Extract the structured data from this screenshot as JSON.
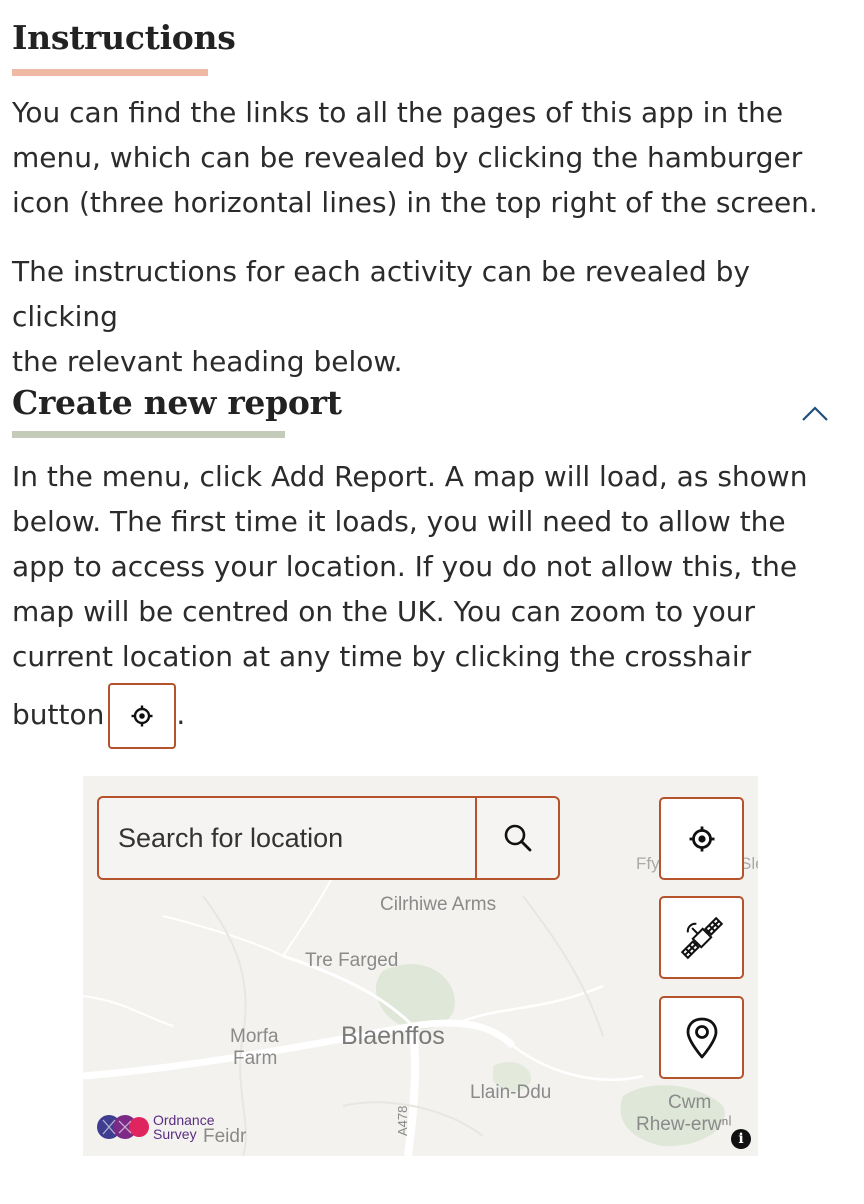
{
  "instructions": {
    "heading": "Instructions",
    "para1_line1": "You can find the links to all the pages of this app in the",
    "para1_line2": "menu, which can be revealed by clicking the hamburger",
    "para1_line3": "icon (three horizontal lines) in the top right of the screen.",
    "para2_line1": "The instructions for each activity can be revealed by clicking",
    "para2_line2": "the relevant heading below."
  },
  "create_report": {
    "heading": "Create new report",
    "line1": "In the menu, click Add Report. A map will load, as shown",
    "line2": "below. The first time it loads, you will need to allow the",
    "line3": "app to access your location. If you do not allow this, the",
    "line4": "map will be centred on the UK. You can zoom to your",
    "line5": "current location at any time by clicking the crosshair",
    "line6_start": "button",
    "line6_end": "."
  },
  "map": {
    "search_placeholder": "Search for location",
    "places": {
      "cilrhiwe": "Cilrhiwe Arms",
      "tre_farged": "Tre Farged",
      "morfa": "Morfa",
      "farm": "Farm",
      "blaenffos": "Blaenffos",
      "llain_ddu": "Llain-Ddu",
      "cwm": "Cwm",
      "rhew": "Rhew-erwⁿˡ",
      "feidr": "Feidr",
      "ffy": "Ffy",
      "sle": "Sle",
      "road": "A478"
    },
    "os_logo_line1": "Ordnance",
    "os_logo_line2": "Survey",
    "info": "i"
  },
  "colors": {
    "accent": "#b5532d",
    "instructions_underline": "#f0b9a4",
    "create_underline": "#c5cbb9",
    "chevron": "#1f4e79"
  },
  "icons": {
    "chevron": "chevron-up-icon",
    "crosshair": "crosshair-icon",
    "search": "search-icon",
    "satellite": "satellite-icon",
    "pin": "map-pin-icon"
  }
}
